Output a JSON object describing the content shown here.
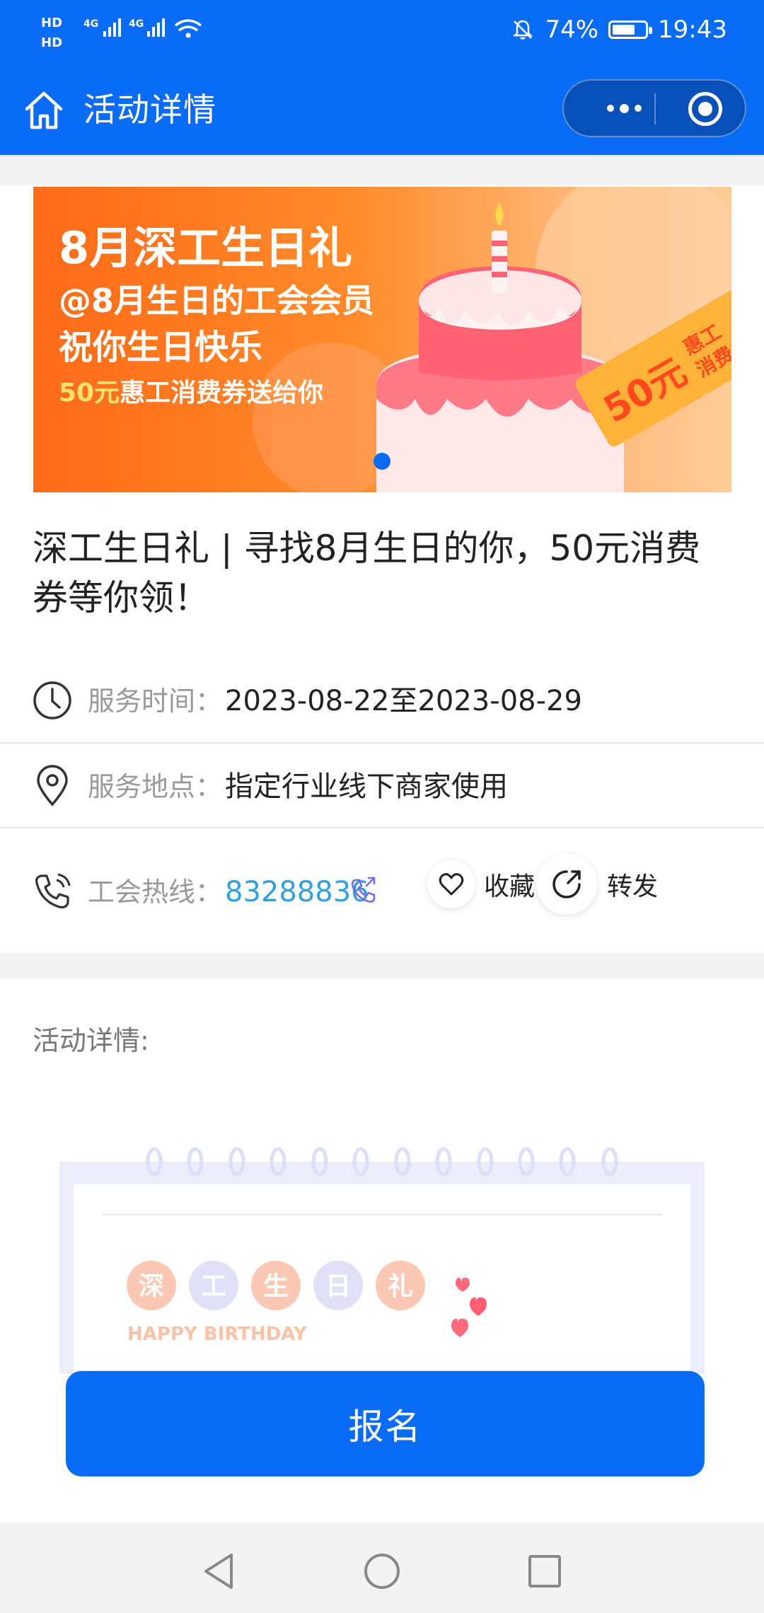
{
  "status_bar": {
    "battery": "74%",
    "time": "19:43",
    "battery_level": 0.74,
    "signal_labels": [
      "HD",
      "HD",
      "4G",
      "4G"
    ]
  },
  "nav": {
    "title": "活动详情",
    "icons": [
      "home-icon",
      "more-icon",
      "close-target-icon"
    ]
  },
  "banner": {
    "line1": "8月深工生日礼",
    "line2": "@8月生日的工会会员",
    "line3": "祝你生日快乐",
    "line4_highlight": "50元",
    "line4_rest": "惠工消费券送给你",
    "badge_amount": "50元",
    "badge_top": "惠工",
    "badge_bottom": "消费券"
  },
  "activity": {
    "title": "深工生日礼 | 寻找8月生日的你，50元消费券等你领！",
    "time_label": "服务时间：",
    "time_value": "2023-08-22至2023-08-29",
    "location_label": "服务地点：",
    "location_value": "指定行业线下商家使用",
    "hotline_label": "工会热线：",
    "hotline_value": "83288836",
    "favorite_label": "收藏",
    "share_label": "转发"
  },
  "detail": {
    "label": "活动详情:",
    "chars": [
      "深",
      "工",
      "生",
      "日",
      "礼"
    ],
    "subtitle": "HAPPY BIRTHDAY"
  },
  "signup_button": "报名",
  "colors": {
    "primary": "#0a6cf6",
    "link": "#32a0e0",
    "banner_orange": "#ff7a1e"
  }
}
